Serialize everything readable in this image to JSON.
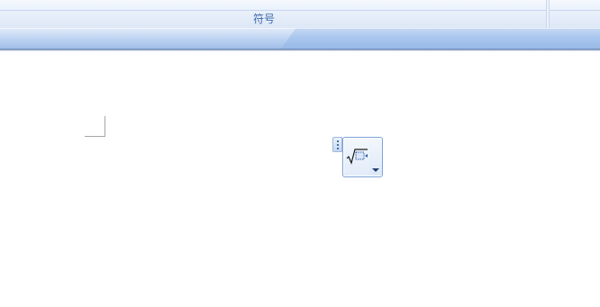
{
  "ribbon": {
    "group_label": "符号"
  },
  "equation_placeholder": {
    "icon": "radical-sqrt-icon",
    "dropdown_icon": "chevron-down-icon"
  },
  "colors": {
    "ribbon_label": "#3e6aa8",
    "ribbon_band": "#a9c6ee",
    "equation_border": "#7ea3d8"
  }
}
